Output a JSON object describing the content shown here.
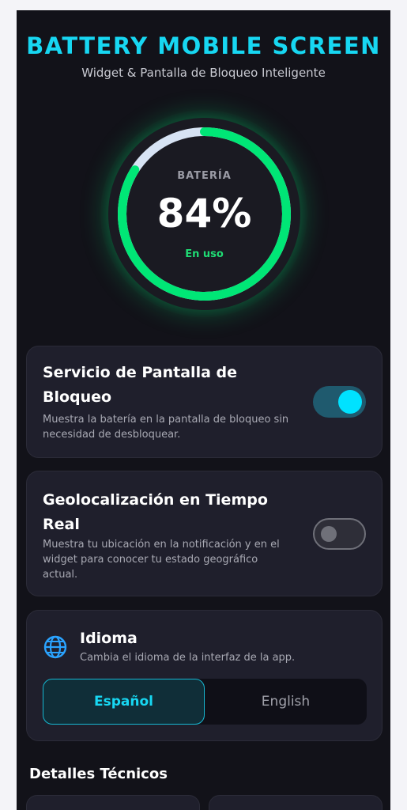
{
  "header": {
    "title": "BATTERY MOBILE SCREEN",
    "subtitle": "Widget & Pantalla de Bloqueo Inteligente"
  },
  "battery": {
    "label": "BATERÍA",
    "percent_text": "84%",
    "level": 0.84,
    "status": "En uso",
    "color_active": "#00e676",
    "color_track": "#d7e3f4"
  },
  "lock_service": {
    "title": "Servicio de Pantalla de Bloqueo",
    "description": "Muestra la batería en la pantalla de bloqueo sin necesidad de desbloquear.",
    "enabled": true
  },
  "geolocation": {
    "title": "Geolocalización en Tiempo Real",
    "description": "Muestra tu ubicación en la notificación y en el widget para conocer tu estado geográfico actual.",
    "enabled": false
  },
  "language": {
    "icon": "globe-icon",
    "title": "Idioma",
    "description": "Cambia el idioma de la interfaz de la app.",
    "options": [
      "Español",
      "English"
    ],
    "selected": "Español"
  },
  "technical": {
    "title": "Detalles Técnicos"
  },
  "colors": {
    "accent": "#17d7f2",
    "background": "#121219",
    "card": "#1f1f2c"
  }
}
